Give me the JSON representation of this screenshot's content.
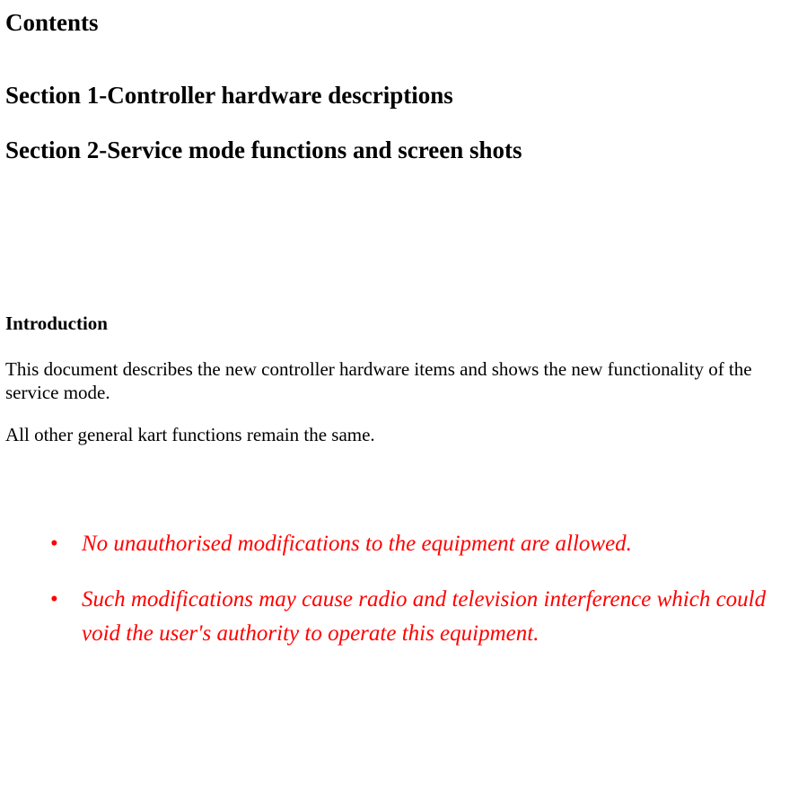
{
  "headings": {
    "contents": "Contents",
    "section1": "Section 1-Controller hardware descriptions",
    "section2": "Section 2-Service mode functions and screen shots",
    "introduction": "Introduction"
  },
  "paragraphs": {
    "p1": "This document describes the new controller hardware items and shows the new functionality of the service mode.",
    "p2": "All other general kart functions remain the same."
  },
  "warnings": {
    "w1": "No unauthorised modifications to the equipment are allowed.",
    "w2": "Such modifications may cause radio and television interference which could void the user's authority to operate this equipment."
  }
}
